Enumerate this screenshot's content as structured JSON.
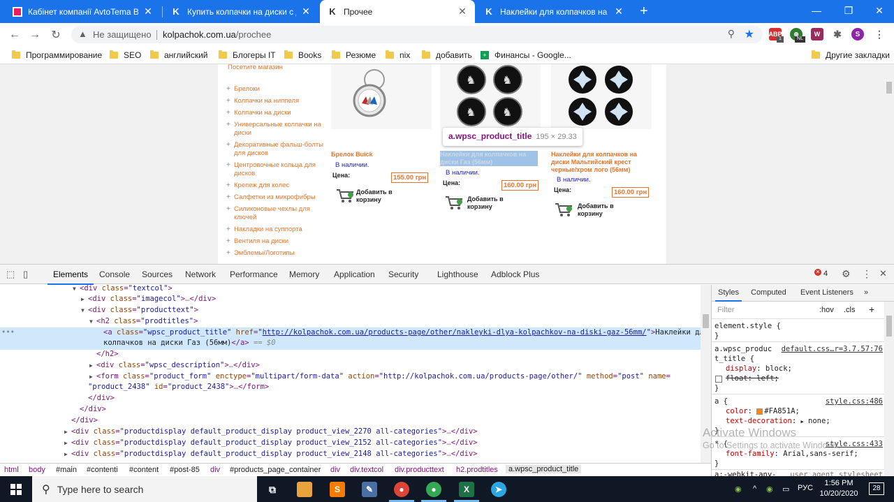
{
  "tabs": [
    {
      "favicon": "avtotema-favicon",
      "title": "Кабінет компанії AvtoTema Buy-",
      "active": false
    },
    {
      "favicon": "k-favicon",
      "title": "Купить колпачки на диски с дос",
      "active": false
    },
    {
      "favicon": "k-favicon",
      "title": "Прочее",
      "active": true
    },
    {
      "favicon": "k-favicon",
      "title": "Наклейки для колпачков на дис",
      "active": false
    }
  ],
  "omnibox": {
    "security": "Не защищено",
    "domain": "kolpachok.com.ua",
    "path": "/prochee"
  },
  "bookmarks": [
    {
      "icon": "folder-icon",
      "label": "Программирование"
    },
    {
      "icon": "folder-icon",
      "label": "SEO"
    },
    {
      "icon": "folder-icon",
      "label": "английский"
    },
    {
      "icon": "folder-icon",
      "label": "Блогеры IT"
    },
    {
      "icon": "folder-icon",
      "label": "Books"
    },
    {
      "icon": "folder-icon",
      "label": "Резюме"
    },
    {
      "icon": "folder-icon",
      "label": "nix"
    },
    {
      "icon": "folder-icon",
      "label": "добавить"
    },
    {
      "icon": "sheets-icon",
      "label": "Финансы - Google..."
    }
  ],
  "other_bookmarks": "Другие закладки",
  "extensions": {
    "abp_badge": "1",
    "nl_badge": "NL",
    "profile_initial": "S"
  },
  "site": {
    "visit_store": "Посетите магазин",
    "categories": [
      "Брелоки",
      "Колпачки на ниппеля",
      "Колпачки на диски",
      "Универсальные колпачки на диски",
      "Декоративные фальш-болты для дисков",
      "Центровочные кольца для дисков",
      "Крепеж для колес",
      "Салфетки из микрофибры",
      "Силиконовые чехлы для ключей",
      "Накладки на суппорта",
      "Вентиля на диски",
      "Эмблемы/Логотипы"
    ],
    "products": [
      {
        "title": "Брелок Buick",
        "stock": "В наличии.",
        "price_label": "Цена:",
        "price": "155.00 грн",
        "add_to_cart": "Добавить в корзину"
      },
      {
        "title": "Наклейки для колпачков на диски Газ (56мм)",
        "stock": "В наличии.",
        "price_label": "Цена:",
        "price": "160.00 грн",
        "add_to_cart": "Добавить в корзину"
      },
      {
        "title": "Наклейки для колпачков на диски Мальтийский крест черные/хром лого (56мм)",
        "stock": "В наличии.",
        "price_label": "Цена:",
        "price": "160.00 грн",
        "add_to_cart": "Добавить в корзину"
      }
    ]
  },
  "tooltip": {
    "selector": "a.wpsc_product_title",
    "size": "195 × 29.33"
  },
  "devtools": {
    "tabs": [
      "Elements",
      "Console",
      "Sources",
      "Network",
      "Performance",
      "Memory",
      "Application",
      "Security",
      "Lighthouse",
      "Adblock Plus"
    ],
    "error_count": "4",
    "dom": {
      "product_link_href": "http://kolpachok.com.ua/products-page/other/nakleyki-dlya-kolpachkov-na-diski-gaz-56mm/",
      "product_link_text_1": "Наклейки для",
      "product_link_text_2": "колпачков на диски Газ (56мм)",
      "form_action": "http://kolpachok.com.ua/products-page/other/",
      "form_name": "product_2438",
      "form_id": "product_2438",
      "view_classes": [
        "productdisplay default_product_display product_view_2270 all-categories",
        "productdisplay default_product_display product_view_2152 all-categories",
        "productdisplay default_product_display product_view_2148 all-categories"
      ]
    },
    "breadcrumbs": [
      "html",
      "body",
      "#main",
      "#contenti",
      "#content",
      "#post-85",
      "div",
      "#products_page_container",
      "div",
      "div.textcol",
      "div.producttext",
      "h2.prodtitles",
      "a.wpsc_product_title"
    ],
    "styles": {
      "tabs": [
        "Styles",
        "Computed",
        "Event Listeners"
      ],
      "filter_placeholder": "Filter",
      "hov": ":hov",
      "cls": ".cls",
      "element_style": "element.style {",
      "rule1_selector_a": "a.wpsc_produc",
      "rule1_selector_b": "t_title {",
      "rule1_source": "default.css…r=3.7.57:76",
      "rule1_prop1": "display",
      "rule1_val1": "block;",
      "rule1_prop2": "float",
      "rule1_val2": "left;",
      "rule2_selector": "a {",
      "rule2_source": "style.css:486",
      "rule2_prop1": "color",
      "rule2_val1": "#FA851A;",
      "rule2_prop2": "text-decoration",
      "rule2_val2": "none;",
      "rule3_selector": "* {",
      "rule3_source": "style.css:433",
      "rule3_prop1": "font-family",
      "rule3_val1": "Arial,sans-serif;",
      "rule4_selector": "a:-webkit-any-",
      "rule4_source": "user agent stylesheet"
    }
  },
  "watermark": {
    "line1": "Activate Windows",
    "line2": "Go to Settings to activate Windows."
  },
  "taskbar": {
    "search_placeholder": "Type here to search",
    "lang": "РУС",
    "time": "1:56 PM",
    "date": "10/20/2020",
    "notifications": "28"
  },
  "colors": {
    "chrome_blue": "#1a73e8",
    "site_orange": "#FA851A",
    "tag_purple": "#881280"
  }
}
